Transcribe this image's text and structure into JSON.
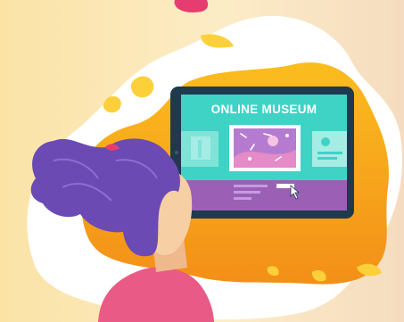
{
  "screen": {
    "title": "ONLINE MUSEUM"
  },
  "colors": {
    "background_left": "#f9dca0",
    "background_right": "#f6e3c4",
    "white_blob": "#ffffff",
    "orange_blob": "#f7a11a",
    "yellow_blob": "#fcd03a",
    "tablet_frame": "#1f3a4f",
    "screen_teal": "#3fd3c6",
    "screen_purple": "#9b5fb6",
    "hair": "#6b4ab3",
    "skin": "#f6cfa5",
    "shirt": "#ea5a86"
  },
  "icons": [
    "cursor-icon",
    "painting-icon",
    "top-item-icon"
  ]
}
